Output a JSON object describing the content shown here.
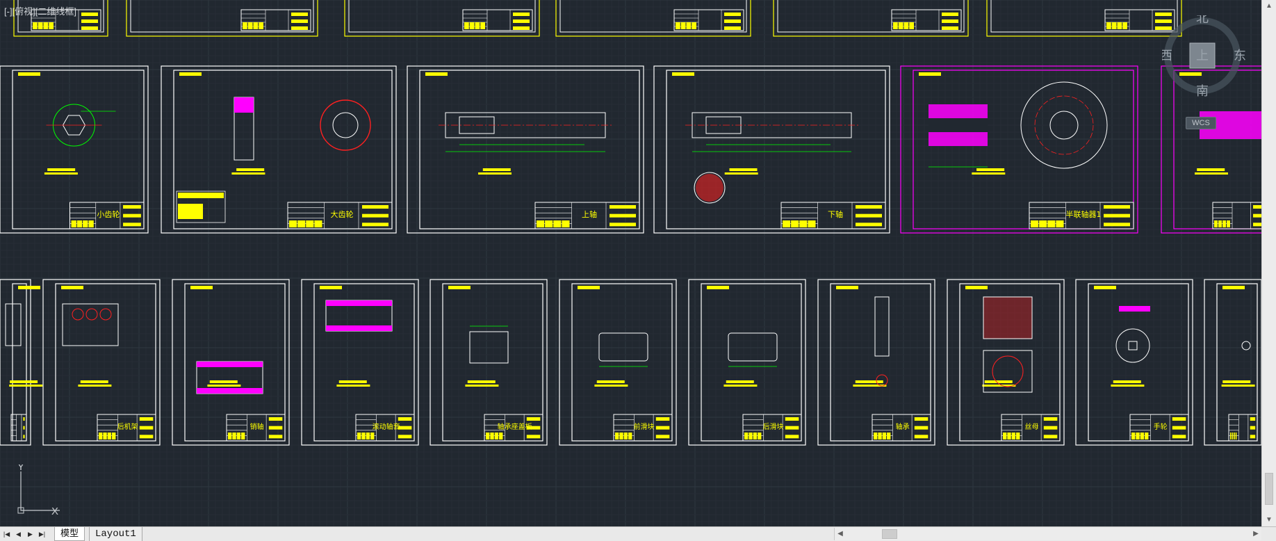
{
  "viewport": {
    "label": "[-][俯视][二维线框]"
  },
  "viewcube": {
    "north": "北",
    "south": "南",
    "east": "东",
    "west": "西",
    "top_face": "上",
    "wcs": "WCS"
  },
  "ucs": {
    "x_label": "X",
    "y_label": "Y"
  },
  "sheets": {
    "row2": [
      {
        "name": "小齿轮",
        "kind": "gear-small"
      },
      {
        "name": "大齿轮",
        "kind": "gear-large"
      },
      {
        "name": "上轴",
        "kind": "shaft"
      },
      {
        "name": "下轴",
        "kind": "shaft2"
      },
      {
        "name": "半联轴器1",
        "kind": "coupling"
      },
      {
        "name": "",
        "kind": "partial"
      }
    ],
    "row3": [
      {
        "name": "",
        "kind": "partial-left"
      },
      {
        "name": "后机架",
        "kind": "frame"
      },
      {
        "name": "销轴",
        "kind": "pin"
      },
      {
        "name": "滚动轴套",
        "kind": "sleeve"
      },
      {
        "name": "轴承座盖板",
        "kind": "plate"
      },
      {
        "name": "前滑块",
        "kind": "block"
      },
      {
        "name": "后滑块",
        "kind": "block"
      },
      {
        "name": "轴承",
        "kind": "axle"
      },
      {
        "name": "丝母",
        "kind": "nut"
      },
      {
        "name": "手轮",
        "kind": "wheel"
      },
      {
        "name": "",
        "kind": "partial-right"
      }
    ]
  },
  "tabs": {
    "model": "模型",
    "layout1": "Layout1"
  },
  "colors": {
    "background": "#212830",
    "sheet_border": "#ffffff",
    "title_block": "#ffff00",
    "dimension": "#00ff00",
    "hatch": "#ff00ff",
    "centerline": "#ff2020",
    "coupling_border": "#ff00ff"
  }
}
